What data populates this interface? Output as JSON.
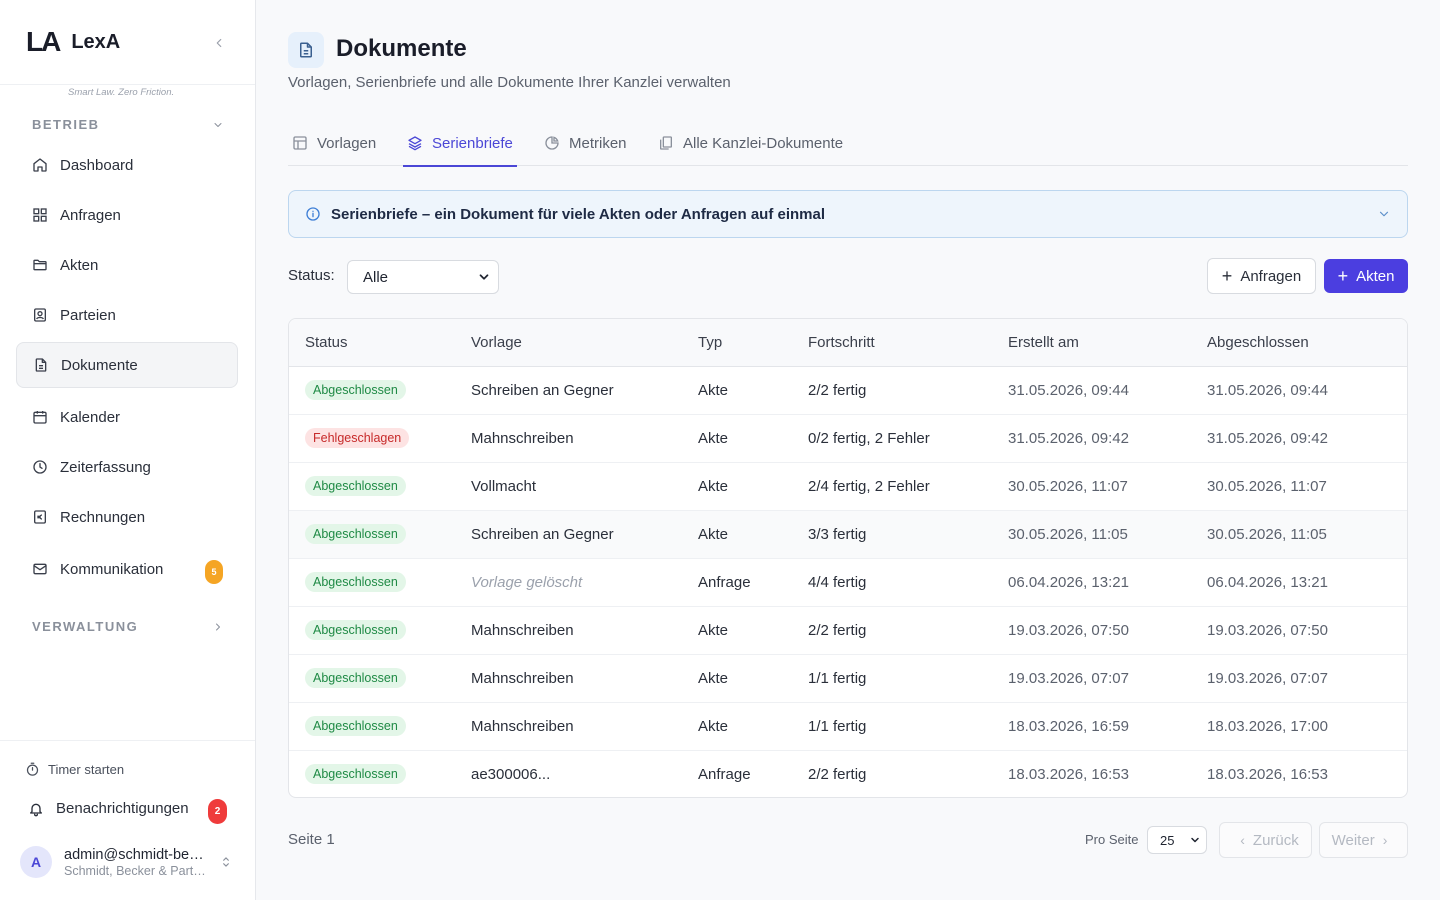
{
  "brand": {
    "logo": "LA",
    "name": "LexA",
    "tagline": "Smart Law. Zero Friction."
  },
  "sidebar": {
    "sections": [
      {
        "label": "BETRIEB"
      },
      {
        "label": "VERWALTUNG"
      }
    ],
    "items": [
      {
        "label": "Dashboard",
        "icon": "home-icon"
      },
      {
        "label": "Anfragen",
        "icon": "grid-icon"
      },
      {
        "label": "Akten",
        "icon": "folder-icon"
      },
      {
        "label": "Parteien",
        "icon": "contact-icon"
      },
      {
        "label": "Dokumente",
        "icon": "document-icon",
        "active": true
      },
      {
        "label": "Kalender",
        "icon": "calendar-icon"
      },
      {
        "label": "Zeiterfassung",
        "icon": "clock-icon"
      },
      {
        "label": "Rechnungen",
        "icon": "invoice-icon"
      },
      {
        "label": "Kommunikation",
        "icon": "mail-icon",
        "badge": "5"
      }
    ],
    "footer": {
      "timer": "Timer starten",
      "notifications": "Benachrichtigungen",
      "notifications_badge": "2",
      "user_initial": "A",
      "user_email": "admin@schmidt-becker.de",
      "user_org": "Schmidt, Becker & Partner"
    }
  },
  "header": {
    "title": "Dokumente",
    "subtitle": "Vorlagen, Serienbriefe und alle Dokumente Ihrer Kanzlei verwalten"
  },
  "tabs": [
    {
      "label": "Vorlagen"
    },
    {
      "label": "Serienbriefe",
      "active": true
    },
    {
      "label": "Metriken"
    },
    {
      "label": "Alle Kanzlei-Dokumente"
    }
  ],
  "info": {
    "text": "Serienbriefe – ein Dokument für viele Akten oder Anfragen auf einmal"
  },
  "toolbar": {
    "status_label": "Status:",
    "status_value": "Alle",
    "btn_anfragen": "Anfragen",
    "btn_akten": "Akten"
  },
  "table": {
    "columns": [
      "Status",
      "Vorlage",
      "Typ",
      "Fortschritt",
      "Erstellt am",
      "Abgeschlossen"
    ],
    "rows": [
      {
        "status": "Abgeschlossen",
        "vorlage": "Schreiben an Gegner",
        "typ": "Akte",
        "fortschritt": "2/2 fertig",
        "erstellt": "31.05.2026, 09:44",
        "abgeschlossen": "31.05.2026, 09:44"
      },
      {
        "status": "Fehlgeschlagen",
        "vorlage": "Mahnschreiben",
        "typ": "Akte",
        "fortschritt": "0/2 fertig, 2 Fehler",
        "erstellt": "31.05.2026, 09:42",
        "abgeschlossen": "31.05.2026, 09:42"
      },
      {
        "status": "Abgeschlossen",
        "vorlage": "Vollmacht",
        "typ": "Akte",
        "fortschritt": "2/4 fertig, 2 Fehler",
        "erstellt": "30.05.2026, 11:07",
        "abgeschlossen": "30.05.2026, 11:07"
      },
      {
        "status": "Abgeschlossen",
        "vorlage": "Schreiben an Gegner",
        "typ": "Akte",
        "fortschritt": "3/3 fertig",
        "erstellt": "30.05.2026, 11:05",
        "abgeschlossen": "30.05.2026, 11:05"
      },
      {
        "status": "Abgeschlossen",
        "vorlage": "Vorlage gelöscht",
        "typ": "Anfrage",
        "fortschritt": "4/4 fertig",
        "erstellt": "06.04.2026, 13:21",
        "abgeschlossen": "06.04.2026, 13:21"
      },
      {
        "status": "Abgeschlossen",
        "vorlage": "Mahnschreiben",
        "typ": "Akte",
        "fortschritt": "2/2 fertig",
        "erstellt": "19.03.2026, 07:50",
        "abgeschlossen": "19.03.2026, 07:50"
      },
      {
        "status": "Abgeschlossen",
        "vorlage": "Mahnschreiben",
        "typ": "Akte",
        "fortschritt": "1/1 fertig",
        "erstellt": "19.03.2026, 07:07",
        "abgeschlossen": "19.03.2026, 07:07"
      },
      {
        "status": "Abgeschlossen",
        "vorlage": "Mahnschreiben",
        "typ": "Akte",
        "fortschritt": "1/1 fertig",
        "erstellt": "18.03.2026, 16:59",
        "abgeschlossen": "18.03.2026, 17:00"
      },
      {
        "status": "Abgeschlossen",
        "vorlage": "ae300006...",
        "typ": "Anfrage",
        "fortschritt": "2/2 fertig",
        "erstellt": "18.03.2026, 16:53",
        "abgeschlossen": "18.03.2026, 16:53"
      }
    ]
  },
  "pagination": {
    "page_label": "Seite 1",
    "per_page_label": "Pro Seite",
    "per_page_value": "25",
    "prev": "Zurück",
    "next": "Weiter"
  },
  "colors": {
    "accent": "#4b3ee0",
    "success": "#1f8a45",
    "error": "#c72a2a",
    "warning_badge": "#f5a524",
    "notify_badge": "#ef3b3b"
  }
}
